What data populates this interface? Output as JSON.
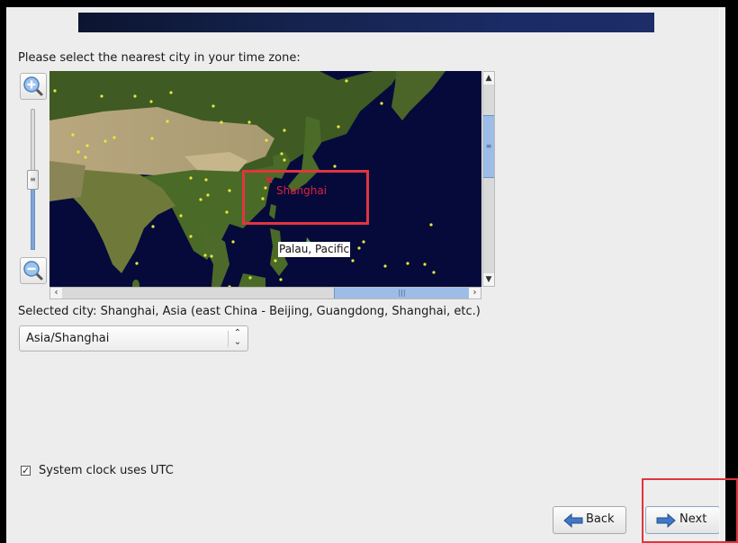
{
  "banner": {
    "color_start": "#0c1530",
    "color_end": "#1c2d68"
  },
  "prompt": "Please select the nearest city in your time zone:",
  "zoom_controls": {
    "zoom_in_icon": "zoom-in-magnifier-icon",
    "zoom_out_icon": "zoom-out-magnifier-icon",
    "zoom_level_fraction": 0.5
  },
  "map": {
    "region": "East Asia / Western Pacific",
    "selected_city_label": "Shanghai",
    "hover_label": "Palau, Pacific",
    "highlight_color": "#e0353f",
    "marker_color": "#e8e83a",
    "selected_marker_color": "#d8253a",
    "vertical_scroll_icon": "scroll-grip-icon",
    "horizontal_scroll_icon": "scroll-grip-icon"
  },
  "selected_city_text": "Selected city: Shanghai, Asia (east China - Beijing, Guangdong, Shanghai, etc.)",
  "timezone_select": {
    "value": "Asia/Shanghai"
  },
  "utc_checkbox": {
    "label": "System clock uses UTC",
    "checked": true
  },
  "buttons": {
    "back": "Back",
    "next": "Next"
  },
  "annotations": {
    "highlight_color": "#e0353f"
  }
}
